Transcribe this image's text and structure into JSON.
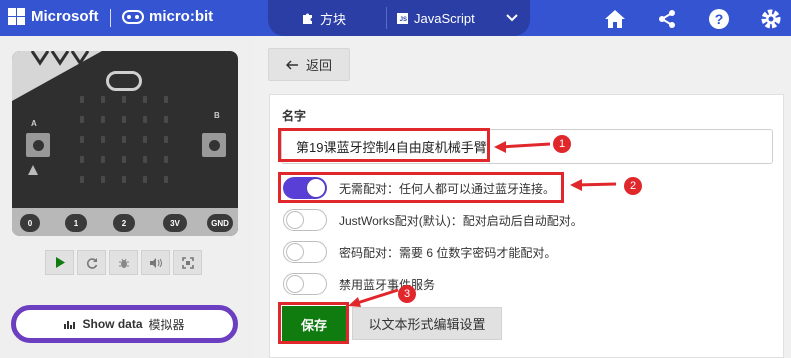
{
  "header": {
    "brand": "Microsoft",
    "product": "micro:bit",
    "tabs": [
      {
        "label": "方块",
        "icon": "puzzle-icon"
      },
      {
        "label": "JavaScript",
        "icon": "javascript-icon"
      }
    ],
    "icons": [
      "chevron-down-icon",
      "home-icon",
      "share-icon",
      "help-icon",
      "gear-icon"
    ],
    "accent_color": "#3454d1"
  },
  "simulator": {
    "pins": [
      "0",
      "1",
      "2",
      "3V",
      "GND"
    ],
    "buttons": [
      "A",
      "B"
    ],
    "toolbar": [
      "play-icon",
      "restart-icon",
      "debug-icon",
      "sound-icon",
      "fullscreen-icon"
    ],
    "show_data_label": "Show data",
    "show_data_suffix": "模拟器"
  },
  "settings": {
    "back_label": "返回",
    "name_label": "名字",
    "name_value": "第19课蓝牙控制4自由度机械手臂",
    "options": [
      {
        "label": "无需配对：任何人都可以通过蓝牙连接。",
        "on": true
      },
      {
        "label": "JustWorks配对(默认)：配对启动后自动配对。",
        "on": false
      },
      {
        "label": "密码配对：需要 6 位数字密码才能配对。",
        "on": false
      },
      {
        "label": "禁用蓝牙事件服务",
        "on": false
      }
    ],
    "save_label": "保存",
    "edit_text_label": "以文本形式编辑设置",
    "save_color": "#107c10"
  },
  "annotations": {
    "callouts": [
      "1",
      "2",
      "3"
    ],
    "color": "#e0282c"
  }
}
